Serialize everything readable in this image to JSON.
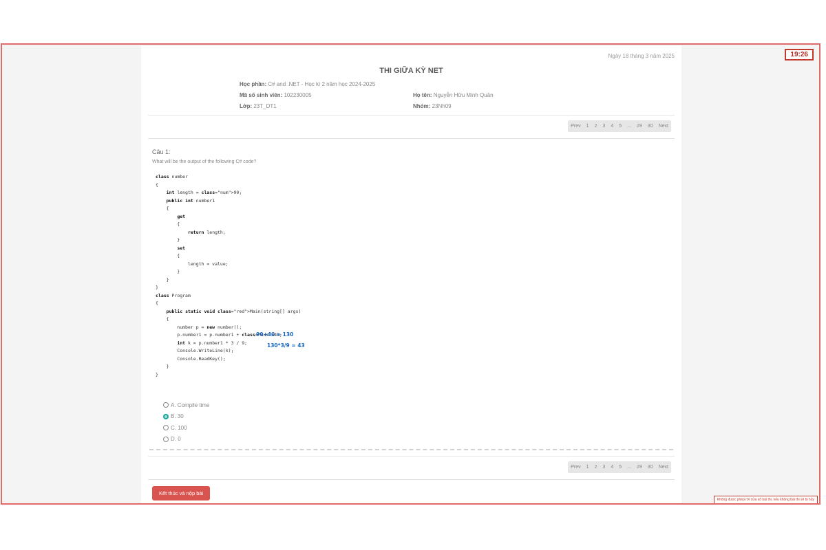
{
  "timer": "19:26",
  "header": {
    "date": "Ngày 18 tháng 3 năm 2025",
    "title": "THI GIỮA KỲ NET",
    "course_label": "Học phần:",
    "course_value": "C# and .NET - Học kì 2 năm học 2024-2025",
    "student_id_label": "Mã số sinh viên:",
    "student_id_value": "102230005",
    "name_label": "Họ tên:",
    "name_value": "Nguyễn Hữu Minh Quân",
    "class_label": "Lớp:",
    "class_value": "23T_DT1",
    "group_label": "Nhóm:",
    "group_value": "23Nh09"
  },
  "pagination": {
    "prev": "Prev",
    "pages": [
      "1",
      "2",
      "3",
      "4",
      "5",
      "...",
      "29",
      "30"
    ],
    "current": "1",
    "next": "Next"
  },
  "question": {
    "title": "Câu 1:",
    "text": "What will be the output of the following C# code?",
    "code": [
      "class number",
      "{",
      "    int length = 90;",
      "    public int number1",
      "    {",
      "        get",
      "        {",
      "            return length;",
      "        }",
      "        set",
      "        {",
      "            length = value;",
      "        }",
      "    }",
      "}",
      "class Program",
      "{",
      "    public static void Main(string[] args)",
      "    {",
      "        number p = new number();",
      "        p.number1 = p.number1 + 40;",
      "        int k = p.number1 * 3 / 9;",
      "        Console.WriteLine(k);",
      "        Console.ReadKey();",
      "    }",
      "}"
    ],
    "annotations": [
      "90+40 = 130",
      "130*3/9 = 43"
    ],
    "options": [
      {
        "letter": "A.",
        "text": "Compile time"
      },
      {
        "letter": "B.",
        "text": "30"
      },
      {
        "letter": "C.",
        "text": "100"
      },
      {
        "letter": "D.",
        "text": "0"
      }
    ],
    "selected": "B."
  },
  "submit_label": "Kết thúc và nộp bài",
  "warning": "Không được phép rời cửa sổ bài thi, nếu không bài thi sẽ bị hủy",
  "colors": {
    "accent": "#d9534f",
    "selected_radio": "#1aa79c",
    "frame_border": "#e06a6a"
  }
}
